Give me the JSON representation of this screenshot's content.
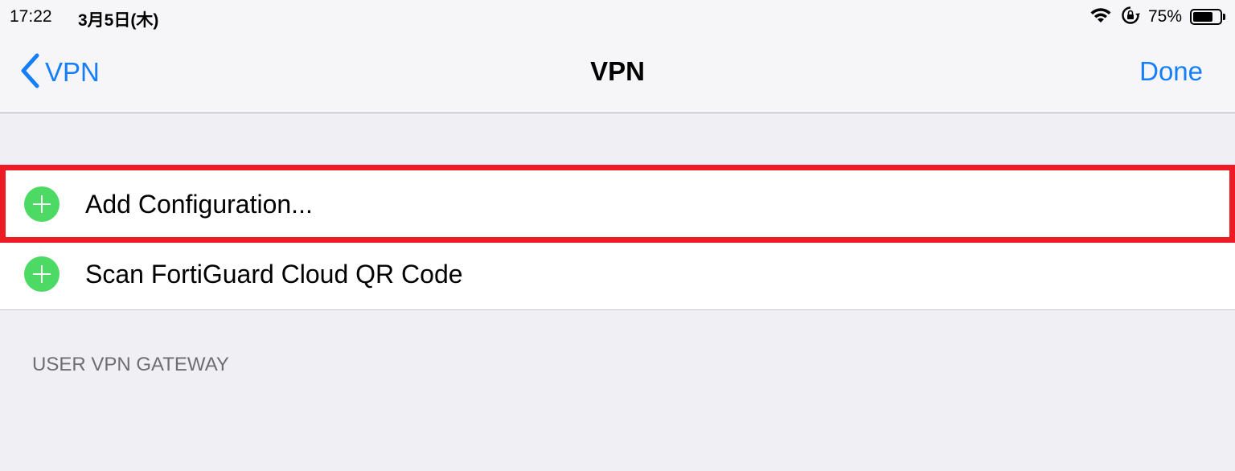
{
  "status_bar": {
    "time": "17:22",
    "date": "3月5日(木)",
    "battery_percent": "75%",
    "battery_level": 0.75,
    "icons": [
      "wifi-icon",
      "orientation-lock-icon",
      "battery-icon"
    ]
  },
  "nav": {
    "back_label": "VPN",
    "title": "VPN",
    "done_label": "Done"
  },
  "list": {
    "items": [
      {
        "label": "Add Configuration...",
        "icon": "plus-circle-icon"
      },
      {
        "label": "Scan FortiGuard Cloud QR Code",
        "icon": "plus-circle-icon"
      }
    ]
  },
  "section": {
    "header": "USER VPN GATEWAY"
  },
  "colors": {
    "accent": "#147efb",
    "add_green": "#4cd964",
    "highlight_red": "#ed1c24",
    "background": "#efeff4"
  }
}
